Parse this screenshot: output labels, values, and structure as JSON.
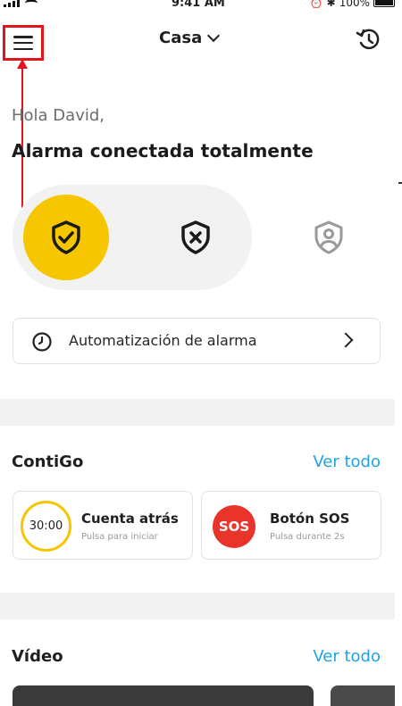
{
  "status_bar": {
    "time": "9:41 AM",
    "battery": "100%"
  },
  "header": {
    "location": "Casa"
  },
  "greeting": "Hola David,",
  "alarm_status": "Alarma conectada totalmente",
  "automation": {
    "label": "Automatización de alarma"
  },
  "contigo": {
    "title": "ContiGo",
    "link": "Ver todo",
    "countdown": {
      "timer": "30:00",
      "title": "Cuenta atrás",
      "subtitle": "Pulsa para iniciar"
    },
    "sos": {
      "badge": "SOS",
      "title": "Botón SOS",
      "subtitle": "Pulsa durante 2s"
    }
  },
  "video": {
    "title": "Vídeo",
    "link": "Ver todo"
  },
  "colors": {
    "accent_yellow": "#f6c600",
    "link_blue": "#1fa3e6",
    "sos_red": "#e8342b",
    "highlight_red": "#e3141c"
  },
  "icons": [
    "menu-icon",
    "chevron-down-icon",
    "history-icon",
    "shield-check-icon",
    "shield-x-icon",
    "shield-user-icon",
    "clock-icon",
    "chevron-right-icon"
  ]
}
